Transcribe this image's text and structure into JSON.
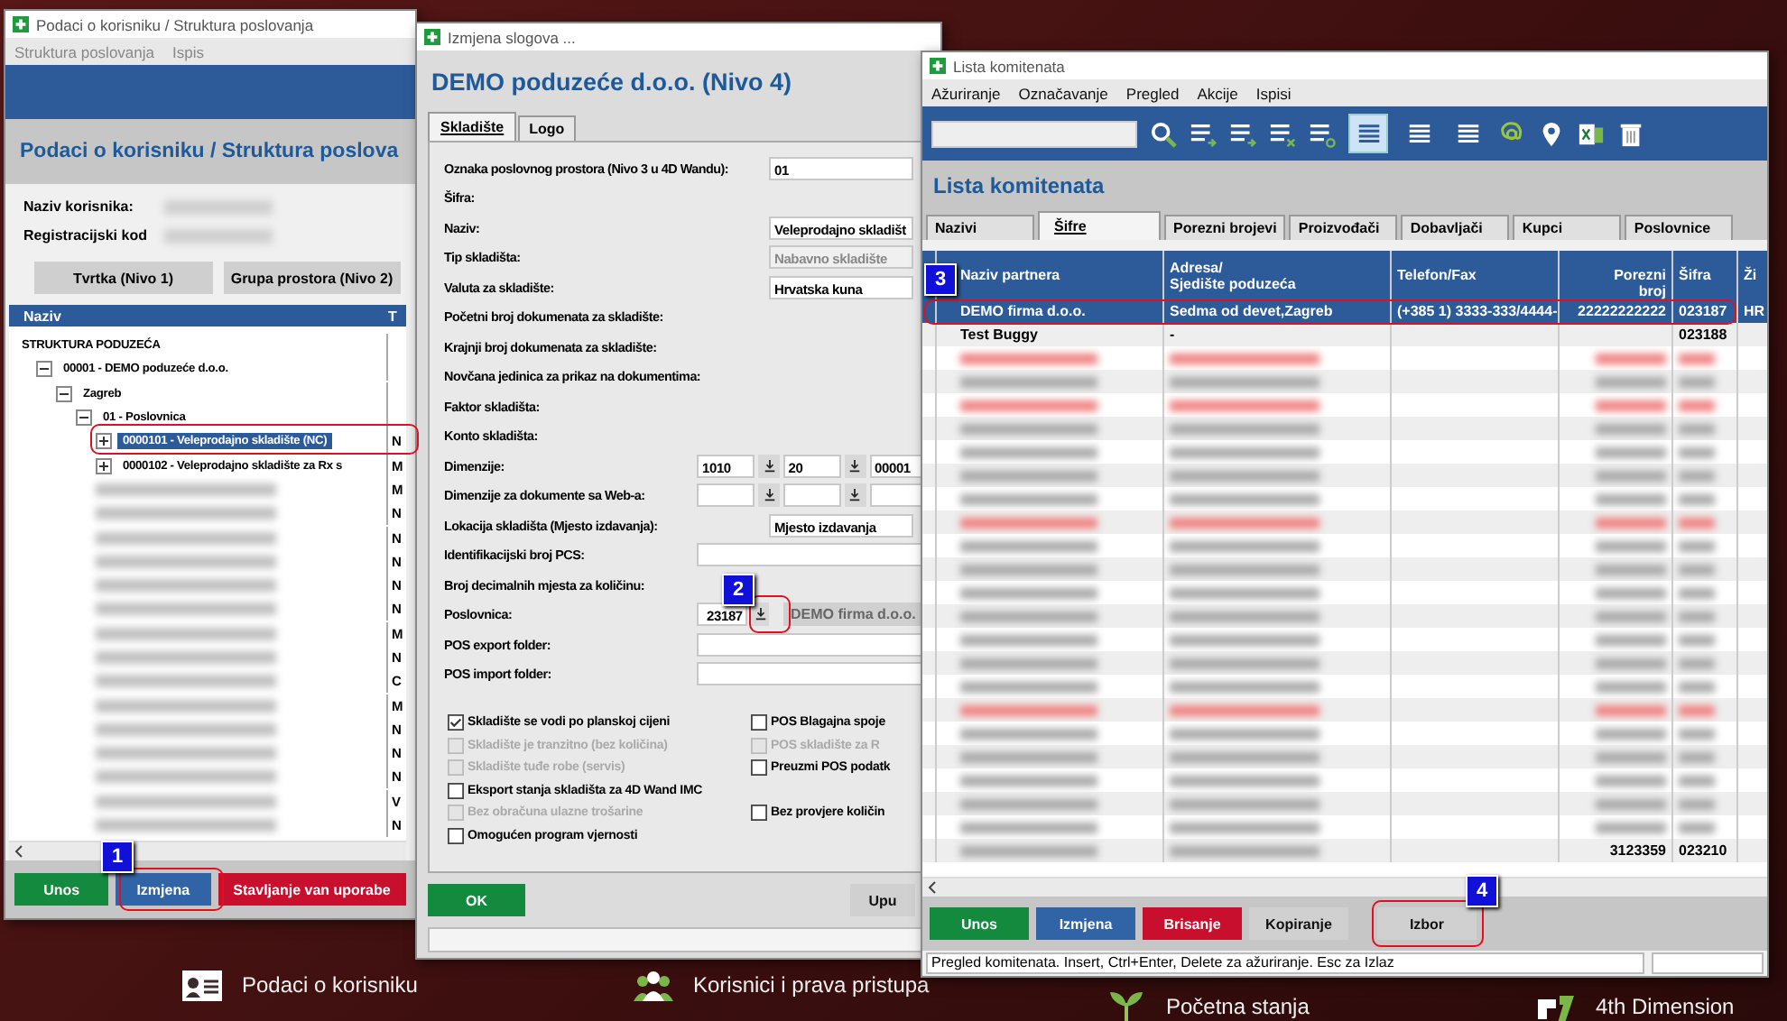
{
  "desktop": {
    "shortcuts": [
      {
        "label": "Podaci o korisniku"
      },
      {
        "label": "Korisnici i prava pristupa"
      },
      {
        "label": "Početna stanja"
      },
      {
        "label": "4th Dimension"
      }
    ]
  },
  "window_struktura": {
    "title": "Podaci o korisniku / Struktura poslovanja",
    "menu": [
      "Struktura poslovanja",
      "Ispis"
    ],
    "heading": "Podaci o korisniku /  Struktura poslova",
    "fields": [
      {
        "label": "Naziv korisnika:"
      },
      {
        "label": "Registracijski kod"
      }
    ],
    "level_buttons": [
      "Tvrtka (Nivo 1)",
      "Grupa prostora (Nivo 2)"
    ],
    "tree_columns": [
      "Naziv",
      "T"
    ],
    "tree": [
      {
        "label": "STRUKTURA PODUZEĆA",
        "children": [
          {
            "label": "00001 - DEMO poduzeće d.o.o.",
            "expanded": true,
            "children": [
              {
                "label": "Zagreb",
                "expanded": true,
                "children": [
                  {
                    "label": "01 - Poslovnica",
                    "expanded": true,
                    "children": [
                      {
                        "label": "0000101 - Veleprodajno skladište (NC)",
                        "type": "N",
                        "expanded": false,
                        "selected": true
                      },
                      {
                        "label": "0000102 - Veleprodajno skladište za Rx s",
                        "type": "M",
                        "expanded": false,
                        "selected": false
                      },
                      {
                        "type": "M",
                        "selected": false
                      },
                      {
                        "type": "N",
                        "selected": false
                      },
                      {
                        "type": "N",
                        "selected": false
                      },
                      {
                        "type": "N",
                        "selected": false
                      },
                      {
                        "type": "N",
                        "selected": false
                      },
                      {
                        "type": "N",
                        "selected": false
                      },
                      {
                        "type": "M",
                        "selected": false
                      },
                      {
                        "type": "N",
                        "selected": false
                      },
                      {
                        "type": "C",
                        "selected": false
                      },
                      {
                        "type": "M",
                        "selected": false
                      },
                      {
                        "type": "N",
                        "selected": false
                      },
                      {
                        "type": "N",
                        "selected": false
                      },
                      {
                        "type": "N",
                        "selected": false
                      },
                      {
                        "type": "V",
                        "selected": false
                      },
                      {
                        "type": "N",
                        "selected": false
                      }
                    ]
                  }
                ]
              }
            ]
          }
        ]
      }
    ],
    "buttons": [
      {
        "label": "Unos",
        "kind": "add"
      },
      {
        "label": "Izmjena",
        "kind": "edit"
      },
      {
        "label": "Stavljanje van uporabe",
        "kind": "delete"
      }
    ]
  },
  "window_izmjena": {
    "title": "Izmjena slogova ...",
    "heading": "DEMO poduzeće d.o.o. (Nivo 4)",
    "tabs": [
      {
        "label": "Skladište",
        "selected": true
      },
      {
        "label": "Logo",
        "selected": false
      }
    ],
    "form": [
      {
        "label": "Oznaka poslovnog prostora (Nivo 3 u 4D Wandu):",
        "kind": "text",
        "value": "01",
        "disabled": false
      },
      {
        "label": "Šifra:",
        "kind": "label"
      },
      {
        "label": "Naziv:",
        "kind": "text",
        "value": "Veleprodajno skladišt",
        "disabled": false
      },
      {
        "label": "Tip skladišta:",
        "kind": "text",
        "value": "Nabavno skladište",
        "disabled": true
      },
      {
        "label": "Valuta za skladište:",
        "kind": "text",
        "value": "Hrvatska kuna",
        "disabled": false
      },
      {
        "label": "Početni broj dokumenata za skladište:",
        "kind": "label"
      },
      {
        "label": "Krajnji broj dokumenata za skladište:",
        "kind": "label"
      },
      {
        "label": "Novčana jedinica za prikaz na dokumentima:",
        "kind": "label"
      },
      {
        "label": "Faktor skladišta:",
        "kind": "label"
      },
      {
        "label": "Konto skladišta:",
        "kind": "label"
      },
      {
        "label": "Dimenzije:",
        "kind": "dims",
        "values": [
          "1010",
          "20",
          "00001"
        ]
      },
      {
        "label": "Dimenzije za dokumente sa Web-a:",
        "kind": "dims_blank"
      },
      {
        "label": "Lokacija skladišta (Mjesto izdavanja):",
        "kind": "text",
        "value": "Mjesto izdavanja",
        "disabled": false
      },
      {
        "label": "Identifikacijski broj PCS:",
        "kind": "input"
      },
      {
        "label": "Broj decimalnih mjesta za količinu:",
        "kind": "label"
      },
      {
        "label": "Poslovnica:",
        "kind": "lookup",
        "value": "23187",
        "name": "DEMO firma d.o.o."
      },
      {
        "label": "POS export folder:",
        "kind": "input"
      },
      {
        "label": "POS import folder:",
        "kind": "input"
      }
    ],
    "checkbox_rows": [
      {
        "left": {
          "label": "Skladište se vodi po planskoj cijeni",
          "checked": true,
          "disabled": false
        },
        "right": {
          "label": "POS Blagajna spoje",
          "checked": false,
          "disabled": false
        }
      },
      {
        "left": {
          "label": "Skladište je tranzitno (bez količina)",
          "checked": false,
          "disabled": true
        },
        "right": {
          "label": "POS skladište za R",
          "checked": false,
          "disabled": true
        }
      },
      {
        "left": {
          "label": "Skladište tuđe robe (servis)",
          "checked": false,
          "disabled": true
        },
        "right": {
          "label": "Preuzmi POS podatk",
          "checked": false,
          "disabled": false
        }
      },
      {
        "left": {
          "label": "Eksport stanja skladišta za 4D Wand IMC",
          "checked": false,
          "disabled": false
        }
      },
      {
        "left": {
          "label": "Bez obračuna ulazne trošarine",
          "checked": false,
          "disabled": true
        },
        "right": {
          "label": "Bez provjere količin",
          "checked": false,
          "disabled": false
        }
      },
      {
        "left": {
          "label": "Omogućen program vjernosti",
          "checked": false,
          "disabled": false
        }
      }
    ],
    "buttons": [
      {
        "label": "OK",
        "kind": "add"
      },
      {
        "label": "Upu",
        "kind": "plain"
      }
    ]
  },
  "window_komitenti": {
    "title": "Lista komitenata",
    "menu": [
      "Ažuriranje",
      "Označavanje",
      "Pregled",
      "Akcije",
      "Ispisi"
    ],
    "view_modes": [
      {
        "selected": true
      },
      {
        "selected": false
      },
      {
        "selected": false
      }
    ],
    "heading": "Lista komitenata",
    "tabs": [
      {
        "label": "Nazivi",
        "selected": false
      },
      {
        "label": "Šifre",
        "selected": true
      },
      {
        "label": "Porezni brojevi",
        "selected": false
      },
      {
        "label": "Proizvođači",
        "selected": false
      },
      {
        "label": "Dobavljači",
        "selected": false
      },
      {
        "label": "Kupci",
        "selected": false
      },
      {
        "label": "Poslovnice",
        "selected": false
      }
    ],
    "columns": [
      {
        "lines": [
          "Naziv partnera"
        ]
      },
      {
        "lines": [
          "Adresa/",
          "Sjedište poduzeća"
        ]
      },
      {
        "lines": [
          "Telefon/Fax"
        ]
      },
      {
        "lines": [
          "Porezni",
          "broj"
        ]
      },
      {
        "lines": [
          "Šifra"
        ]
      },
      {
        "lines": [
          "Ži"
        ]
      }
    ],
    "rows": [
      {
        "kind": "data",
        "selected": true,
        "name": "DEMO firma d.o.o.",
        "address": "Sedma od devet,Zagreb",
        "phone": "(+385 1) 3333-333/4444-",
        "tax_no": "22222222222",
        "code": "023187",
        "column_6": "HR"
      },
      {
        "kind": "data",
        "selected": false,
        "name": "Test Buggy",
        "address": "-",
        "code": "023188"
      },
      {
        "kind": "blurred",
        "selected": false,
        "inactive": true
      },
      {
        "kind": "blurred",
        "selected": false,
        "inactive": false
      },
      {
        "kind": "blurred",
        "selected": false,
        "inactive": true
      },
      {
        "kind": "blurred",
        "selected": false,
        "inactive": false
      },
      {
        "kind": "blurred",
        "selected": false,
        "inactive": false
      },
      {
        "kind": "blurred",
        "selected": false,
        "inactive": false
      },
      {
        "kind": "blurred",
        "selected": false,
        "inactive": false
      },
      {
        "kind": "blurred",
        "selected": false,
        "inactive": true
      },
      {
        "kind": "blurred",
        "selected": false,
        "inactive": false
      },
      {
        "kind": "blurred",
        "selected": false,
        "inactive": false
      },
      {
        "kind": "blurred",
        "selected": false,
        "inactive": false
      },
      {
        "kind": "blurred",
        "selected": false,
        "inactive": false
      },
      {
        "kind": "blurred",
        "selected": false,
        "inactive": false
      },
      {
        "kind": "blurred",
        "selected": false,
        "inactive": false
      },
      {
        "kind": "blurred",
        "selected": false,
        "inactive": false
      },
      {
        "kind": "blurred",
        "selected": false,
        "inactive": true
      },
      {
        "kind": "blurred",
        "selected": false,
        "inactive": false
      },
      {
        "kind": "blurred",
        "selected": false,
        "inactive": false
      },
      {
        "kind": "blurred",
        "selected": false,
        "inactive": false
      },
      {
        "kind": "blurred",
        "selected": false,
        "inactive": false
      },
      {
        "kind": "blurred",
        "selected": false,
        "inactive": false
      },
      {
        "kind": "blurred",
        "selected": false,
        "inactive": false,
        "tax_no": "3123359",
        "code": "023210"
      }
    ],
    "buttons": [
      {
        "label": "Unos",
        "kind": "add"
      },
      {
        "label": "Izmjena",
        "kind": "edit"
      },
      {
        "label": "Brisanje",
        "kind": "delete"
      },
      {
        "label": "Kopiranje",
        "kind": "plain"
      },
      {
        "label": "Izbor",
        "kind": "plain"
      }
    ],
    "status": "Pregled komitenata. Insert, Ctrl+Enter, Delete za ažuriranje. Esc za Izlaz"
  },
  "callouts": [
    "1",
    "2",
    "3",
    "4"
  ]
}
